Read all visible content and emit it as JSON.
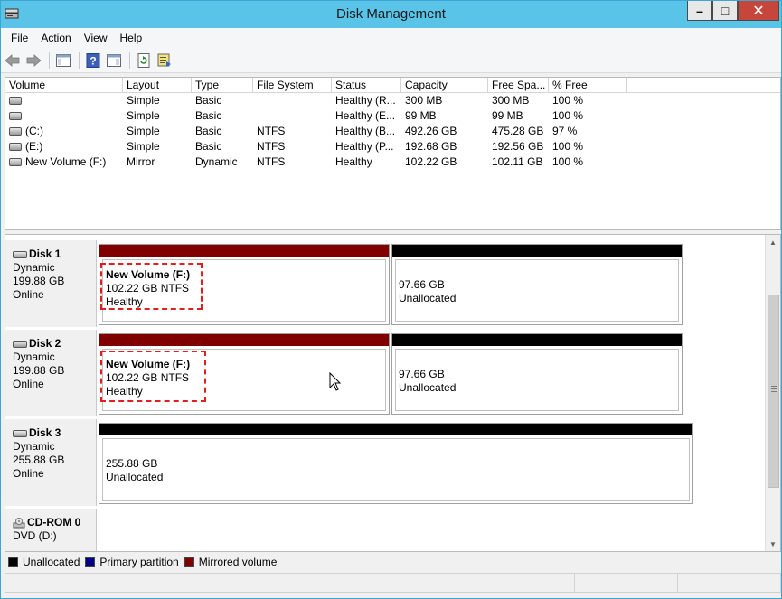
{
  "window": {
    "title": "Disk Management",
    "controls": {
      "minimize": "–",
      "maximize": "□",
      "close": "✕"
    }
  },
  "menu": [
    "File",
    "Action",
    "View",
    "Help"
  ],
  "toolbar": {
    "icons": [
      "back-arrow-icon",
      "forward-arrow-icon",
      "properties-pane-icon",
      "help-icon",
      "console-view-icon",
      "refresh-icon",
      "export-list-icon"
    ]
  },
  "volume_list": {
    "columns": [
      "Volume",
      "Layout",
      "Type",
      "File System",
      "Status",
      "Capacity",
      "Free Spa...",
      "% Free"
    ],
    "rows": [
      {
        "volume": "",
        "layout": "Simple",
        "type": "Basic",
        "fs": "",
        "status": "Healthy (R...",
        "capacity": "300 MB",
        "free": "300 MB",
        "pct": "100 %"
      },
      {
        "volume": "",
        "layout": "Simple",
        "type": "Basic",
        "fs": "",
        "status": "Healthy (E...",
        "capacity": "99 MB",
        "free": "99 MB",
        "pct": "100 %"
      },
      {
        "volume": "(C:)",
        "layout": "Simple",
        "type": "Basic",
        "fs": "NTFS",
        "status": "Healthy (B...",
        "capacity": "492.26 GB",
        "free": "475.28 GB",
        "pct": "97 %"
      },
      {
        "volume": "(E:)",
        "layout": "Simple",
        "type": "Basic",
        "fs": "NTFS",
        "status": "Healthy (P...",
        "capacity": "192.68 GB",
        "free": "192.56 GB",
        "pct": "100 %"
      },
      {
        "volume": "New Volume (F:)",
        "layout": "Mirror",
        "type": "Dynamic",
        "fs": "NTFS",
        "status": "Healthy",
        "capacity": "102.22 GB",
        "free": "102.11 GB",
        "pct": "100 %"
      }
    ]
  },
  "disks": [
    {
      "name": "Disk 1",
      "type": "Dynamic",
      "size": "199.88 GB",
      "state": "Online",
      "partitions": [
        {
          "title": "New Volume  (F:)",
          "size": "102.22 GB NTFS",
          "status": "Healthy",
          "kind": "mirror"
        },
        {
          "title": "",
          "size": "97.66 GB",
          "status": "Unallocated",
          "kind": "unallocated"
        }
      ]
    },
    {
      "name": "Disk 2",
      "type": "Dynamic",
      "size": "199.88 GB",
      "state": "Online",
      "partitions": [
        {
          "title": "New Volume  (F:)",
          "size": "102.22 GB NTFS",
          "status": "Healthy",
          "kind": "mirror"
        },
        {
          "title": "",
          "size": "97.66 GB",
          "status": "Unallocated",
          "kind": "unallocated"
        }
      ]
    },
    {
      "name": "Disk 3",
      "type": "Dynamic",
      "size": "255.88 GB",
      "state": "Online",
      "partitions": [
        {
          "title": "",
          "size": "255.88 GB",
          "status": "Unallocated",
          "kind": "unallocated"
        }
      ]
    },
    {
      "name": "CD-ROM 0",
      "type": "DVD (D:)",
      "size": "",
      "state": "",
      "partitions": []
    }
  ],
  "legend": [
    {
      "label": "Unallocated",
      "color": "#000000"
    },
    {
      "label": "Primary partition",
      "color": "#000080"
    },
    {
      "label": "Mirrored volume",
      "color": "#800000"
    }
  ]
}
